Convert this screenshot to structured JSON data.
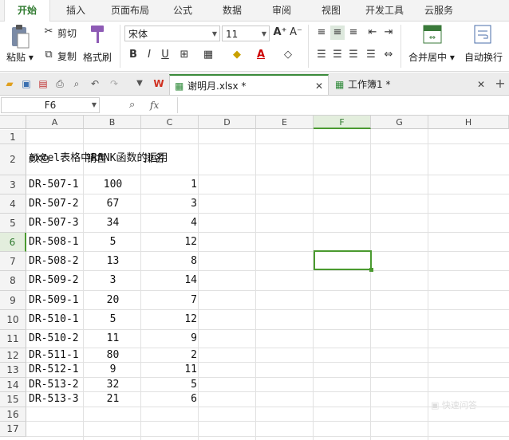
{
  "menu": {
    "tabs": [
      "开始",
      "插入",
      "页面布局",
      "公式",
      "数据",
      "审阅",
      "视图",
      "开发工具",
      "云服务"
    ],
    "active_index": 0
  },
  "ribbon": {
    "paste": "粘贴",
    "cut": "剪切",
    "copy": "复制",
    "format_painter": "格式刷",
    "font_name": "宋体",
    "font_size": "11",
    "merge_center": "合并居中",
    "wrap_text": "自动换行"
  },
  "tabs": {
    "doc1": "谢明月.xlsx *",
    "doc2": "工作簿1 *"
  },
  "formula": {
    "name_box": "F6",
    "fx": "fx",
    "content": ""
  },
  "sheet": {
    "columns": [
      "A",
      "B",
      "C",
      "D",
      "E",
      "F",
      "G",
      "H"
    ],
    "rows": [
      "1",
      "2",
      "3",
      "4",
      "5",
      "6",
      "7",
      "8",
      "9",
      "10",
      "11",
      "12",
      "13",
      "14",
      "15",
      "16",
      "17"
    ],
    "title": "excel表格中RANK函数的运用",
    "headers": [
      "颜色",
      "销售",
      "排名"
    ],
    "data": [
      [
        "DR-507-1",
        "100",
        "1"
      ],
      [
        "DR-507-2",
        "67",
        "3"
      ],
      [
        "DR-507-3",
        "34",
        "4"
      ],
      [
        "DR-508-1",
        "5",
        "12"
      ],
      [
        "DR-508-2",
        "13",
        "8"
      ],
      [
        "DR-509-2",
        "3",
        "14"
      ],
      [
        "DR-509-1",
        "20",
        "7"
      ],
      [
        "DR-510-1",
        "5",
        "12"
      ],
      [
        "DR-510-2",
        "11",
        "9"
      ],
      [
        "DR-511-1",
        "80",
        "2"
      ],
      [
        "DR-512-1",
        "9",
        "11"
      ],
      [
        "DR-513-2",
        "32",
        "5"
      ],
      [
        "DR-513-3",
        "21",
        "6"
      ]
    ],
    "selected_cell": "F6"
  },
  "colors": {
    "accent": "#2f7a2f",
    "selection": "#4a9a2f"
  }
}
